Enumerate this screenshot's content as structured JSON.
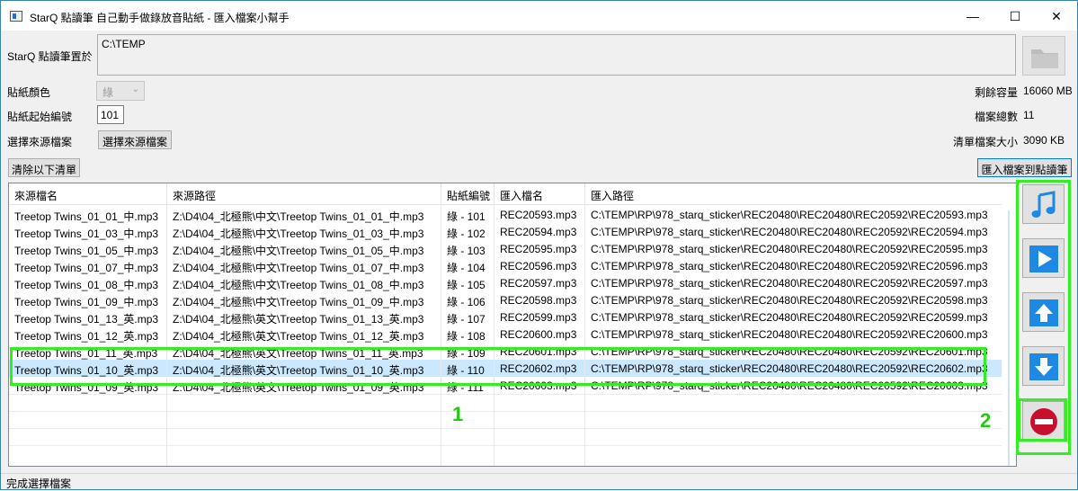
{
  "window": {
    "title": "StarQ 點讀筆 自己動手做錄放音貼紙 - 匯入檔案小幫手",
    "minimize": "—",
    "maximize": "☐",
    "close": "✕"
  },
  "form": {
    "pen_location_label": "StarQ 點讀筆置於",
    "pen_location_value": "C:\\TEMP",
    "sticker_color_label": "貼紙顏色",
    "sticker_color_value": "綠",
    "start_number_label": "貼紙起始編號",
    "start_number_value": "101",
    "source_label": "選擇來源檔案",
    "source_button": "選擇來源檔案",
    "clear_button": "清除以下清單",
    "import_button": "匯入檔案到點讀筆"
  },
  "info": {
    "remaining_label": "剩餘容量",
    "remaining_value": "16060 MB",
    "total_files_label": "檔案總數",
    "total_files_value": "11",
    "list_size_label": "清單檔案大小",
    "list_size_value": "3090 KB"
  },
  "table": {
    "columns": [
      "來源檔名",
      "來源路徑",
      "貼紙編號",
      "匯入檔名",
      "匯入路徑"
    ],
    "rows": [
      [
        "Treetop Twins_01_01_中.mp3",
        "Z:\\D4\\04_北極熊\\中文\\Treetop Twins_01_01_中.mp3",
        "綠 - 101",
        "REC20593.mp3",
        "C:\\TEMP\\RP\\978_starq_sticker\\REC20480\\REC20480\\REC20592\\REC20593.mp3"
      ],
      [
        "Treetop Twins_01_03_中.mp3",
        "Z:\\D4\\04_北極熊\\中文\\Treetop Twins_01_03_中.mp3",
        "綠 - 102",
        "REC20594.mp3",
        "C:\\TEMP\\RP\\978_starq_sticker\\REC20480\\REC20480\\REC20592\\REC20594.mp3"
      ],
      [
        "Treetop Twins_01_05_中.mp3",
        "Z:\\D4\\04_北極熊\\中文\\Treetop Twins_01_05_中.mp3",
        "綠 - 103",
        "REC20595.mp3",
        "C:\\TEMP\\RP\\978_starq_sticker\\REC20480\\REC20480\\REC20592\\REC20595.mp3"
      ],
      [
        "Treetop Twins_01_07_中.mp3",
        "Z:\\D4\\04_北極熊\\中文\\Treetop Twins_01_07_中.mp3",
        "綠 - 104",
        "REC20596.mp3",
        "C:\\TEMP\\RP\\978_starq_sticker\\REC20480\\REC20480\\REC20592\\REC20596.mp3"
      ],
      [
        "Treetop Twins_01_08_中.mp3",
        "Z:\\D4\\04_北極熊\\中文\\Treetop Twins_01_08_中.mp3",
        "綠 - 105",
        "REC20597.mp3",
        "C:\\TEMP\\RP\\978_starq_sticker\\REC20480\\REC20480\\REC20592\\REC20597.mp3"
      ],
      [
        "Treetop Twins_01_09_中.mp3",
        "Z:\\D4\\04_北極熊\\中文\\Treetop Twins_01_09_中.mp3",
        "綠 - 106",
        "REC20598.mp3",
        "C:\\TEMP\\RP\\978_starq_sticker\\REC20480\\REC20480\\REC20592\\REC20598.mp3"
      ],
      [
        "Treetop Twins_01_13_英.mp3",
        "Z:\\D4\\04_北極熊\\英文\\Treetop Twins_01_13_英.mp3",
        "綠 - 107",
        "REC20599.mp3",
        "C:\\TEMP\\RP\\978_starq_sticker\\REC20480\\REC20480\\REC20592\\REC20599.mp3"
      ],
      [
        "Treetop Twins_01_12_英.mp3",
        "Z:\\D4\\04_北極熊\\英文\\Treetop Twins_01_12_英.mp3",
        "綠 - 108",
        "REC20600.mp3",
        "C:\\TEMP\\RP\\978_starq_sticker\\REC20480\\REC20480\\REC20592\\REC20600.mp3"
      ],
      [
        "Treetop Twins_01_11_英.mp3",
        "Z:\\D4\\04_北極熊\\英文\\Treetop Twins_01_11_英.mp3",
        "綠 - 109",
        "REC20601.mp3",
        "C:\\TEMP\\RP\\978_starq_sticker\\REC20480\\REC20480\\REC20592\\REC20601.mp3"
      ],
      [
        "Treetop Twins_01_10_英.mp3",
        "Z:\\D4\\04_北極熊\\英文\\Treetop Twins_01_10_英.mp3",
        "綠 - 110",
        "REC20602.mp3",
        "C:\\TEMP\\RP\\978_starq_sticker\\REC20480\\REC20480\\REC20592\\REC20602.mp3"
      ],
      [
        "Treetop Twins_01_09_英.mp3",
        "Z:\\D4\\04_北極熊\\英文\\Treetop Twins_01_09_英.mp3",
        "綠 - 111",
        "REC20603.mp3",
        "C:\\TEMP\\RP\\978_starq_sticker\\REC20480\\REC20480\\REC20592\\REC20603.mp3"
      ]
    ],
    "selected_row": 9
  },
  "side_buttons": [
    "music-note-icon",
    "play-icon",
    "arrow-up-icon",
    "arrow-down-icon",
    "remove-icon"
  ],
  "status": "完成選擇檔案",
  "annotations": {
    "label_1": "1",
    "label_2": "2",
    "color": "#33ee22"
  },
  "colors": {
    "selection": "#cce8ff",
    "icon_blue": "#1e88e5",
    "remove_red": "#c8102e",
    "accent_border": "#0078d7"
  }
}
